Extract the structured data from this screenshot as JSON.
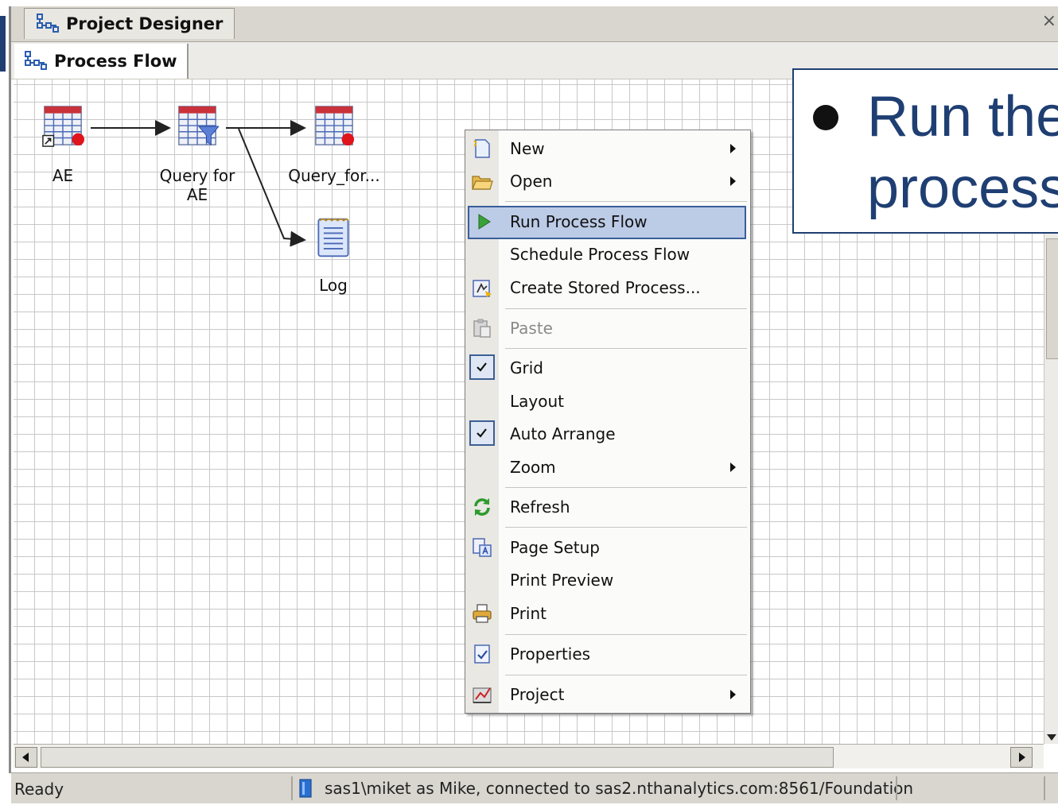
{
  "window": {
    "tab_title": "Project Designer",
    "close_glyph": "×"
  },
  "process_flow_tab": {
    "label": "Process Flow"
  },
  "nodes": [
    {
      "id": "ae",
      "label": "AE",
      "icon": "data-table-icon"
    },
    {
      "id": "query",
      "label_line1": "Query for",
      "label_line2": "AE",
      "icon": "query-table-icon"
    },
    {
      "id": "query_for",
      "label": "Query_for...",
      "icon": "data-table-icon"
    },
    {
      "id": "log",
      "label": "Log",
      "icon": "log-document-icon"
    }
  ],
  "context_menu": {
    "items": [
      {
        "label": "New",
        "icon": "new-document-icon",
        "submenu": true
      },
      {
        "label": "Open",
        "icon": "open-folder-icon",
        "submenu": true
      },
      {
        "label": "Run Process Flow",
        "icon": "run-play-icon",
        "highlighted": true
      },
      {
        "label": "Schedule Process Flow"
      },
      {
        "label": "Create Stored Process...",
        "icon": "stored-process-icon"
      },
      {
        "label": "Paste",
        "icon": "paste-icon",
        "disabled": true
      },
      {
        "label": "Grid",
        "checked": true
      },
      {
        "label": "Layout"
      },
      {
        "label": "Auto Arrange",
        "checked": true
      },
      {
        "label": "Zoom",
        "submenu": true
      },
      {
        "label": "Refresh",
        "icon": "refresh-icon"
      },
      {
        "label": "Page Setup",
        "icon": "page-setup-icon"
      },
      {
        "label": "Print Preview"
      },
      {
        "label": "Print",
        "icon": "printer-icon"
      },
      {
        "label": "Properties",
        "icon": "properties-icon"
      },
      {
        "label": "Project",
        "icon": "project-icon",
        "submenu": true
      }
    ]
  },
  "callout": {
    "line1": "Run the",
    "line2": "process"
  },
  "status": {
    "ready": "Ready",
    "connection": "sas1\\miket as Mike, connected to sas2.nthanalytics.com:8561/Foundation"
  },
  "colors": {
    "accent": "#1f3f73",
    "highlight": "#bccbe6",
    "chrome": "#d9d6cf"
  }
}
